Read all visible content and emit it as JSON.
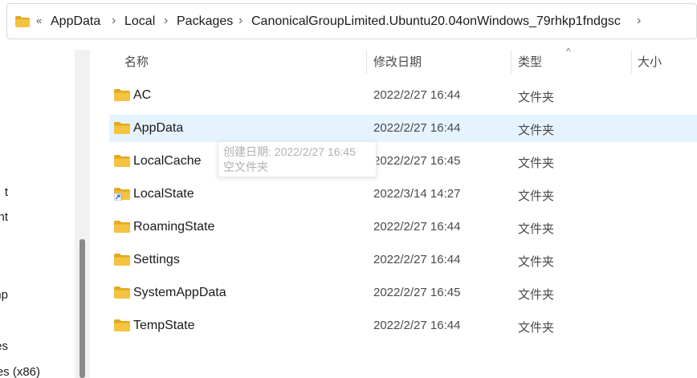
{
  "breadcrumb": {
    "overflow": "«",
    "items": [
      "AppData",
      "Local",
      "Packages",
      "CanonicalGroupLimited.Ubuntu20.04onWindows_79rhkp1fndgsc"
    ],
    "separator": "›"
  },
  "nav": {
    "items": [
      "t",
      "nt",
      "mp",
      "es",
      "es (x86)"
    ]
  },
  "columns": {
    "name": "名称",
    "modified": "修改日期",
    "type": "类型",
    "size": "大小",
    "sort_indicator": "^"
  },
  "rows": [
    {
      "name": "AC",
      "date": "2022/2/27 16:44",
      "type": "文件夹",
      "icon": "folder-icon"
    },
    {
      "name": "AppData",
      "date": "2022/2/27 16:44",
      "type": "文件夹",
      "icon": "folder-icon"
    },
    {
      "name": "LocalCache",
      "date": "2022/2/27 16:45",
      "type": "文件夹",
      "icon": "folder-icon"
    },
    {
      "name": "LocalState",
      "date": "2022/3/14 14:27",
      "type": "文件夹",
      "icon": "folder-shortcut-icon"
    },
    {
      "name": "RoamingState",
      "date": "2022/2/27 16:44",
      "type": "文件夹",
      "icon": "folder-icon"
    },
    {
      "name": "Settings",
      "date": "2022/2/27 16:44",
      "type": "文件夹",
      "icon": "folder-icon"
    },
    {
      "name": "SystemAppData",
      "date": "2022/2/27 16:45",
      "type": "文件夹",
      "icon": "folder-icon"
    },
    {
      "name": "TempState",
      "date": "2022/2/27 16:44",
      "type": "文件夹",
      "icon": "folder-icon"
    }
  ],
  "selected_row": "AppData",
  "tooltip": {
    "created": "创建日期: 2022/2/27 16:45",
    "status": "空文件夹"
  },
  "colors": {
    "selection": "#e5f3ff",
    "folder": "#f5c242",
    "folder_dark": "#e3a91f"
  }
}
